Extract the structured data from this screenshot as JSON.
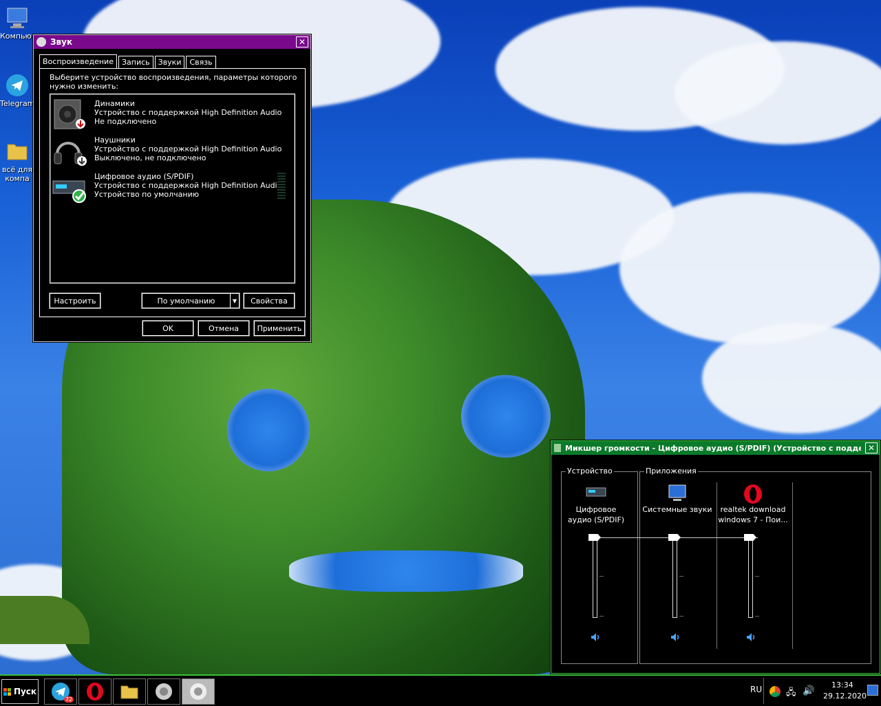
{
  "desktop": {
    "icons": [
      {
        "label": "Компьютер"
      },
      {
        "label": "Telegram"
      },
      {
        "label": "всё для компа"
      }
    ]
  },
  "sound_dialog": {
    "title": "Звук",
    "tabs": [
      "Воспроизведение",
      "Запись",
      "Звуки",
      "Связь"
    ],
    "hint": "Выберите устройство воспроизведения, параметры которого нужно изменить:",
    "devices": [
      {
        "name": "Динамики",
        "desc": "Устройство с поддержкой High Definition Audio",
        "status": "Не подключено",
        "icon": "speaker-icon"
      },
      {
        "name": "Наушники",
        "desc": "Устройство с поддержкой High Definition Audio",
        "status": "Выключено, не подключено",
        "icon": "headphones-icon"
      },
      {
        "name": "Цифровое аудио (S/PDIF)",
        "desc": "Устройство с поддержкой High Definition Audio",
        "status": "Устройство по умолчанию",
        "icon": "digital-audio-icon"
      }
    ],
    "buttons": {
      "configure": "Настроить",
      "default": "По умолчанию",
      "properties": "Свойства",
      "ok": "OK",
      "cancel": "Отмена",
      "apply": "Применить"
    }
  },
  "mixer": {
    "title": "Микшер громкости - Цифровое аудио (S/PDIF) (Устройство с поддер...",
    "device_group": "Устройство",
    "apps_group": "Приложения",
    "columns": [
      {
        "name_line1": "Цифровое",
        "name_line2": "аудио (S/PDIF)",
        "volume": 1.0
      },
      {
        "name_line1": "Системные звуки",
        "name_line2": "",
        "volume": 1.0
      },
      {
        "name_line1": "realtek download",
        "name_line2": "windows 7 - Пои...",
        "volume": 1.0
      }
    ]
  },
  "taskbar": {
    "start_label": "Пуск",
    "telegram_badge": "72",
    "lang": "RU",
    "time": "13:34",
    "date": "29.12.2020"
  },
  "colors": {
    "sound_title": "#7a0a8c",
    "mixer_title": "#0b7a2a",
    "taskbar_border": "#3cc03c"
  }
}
